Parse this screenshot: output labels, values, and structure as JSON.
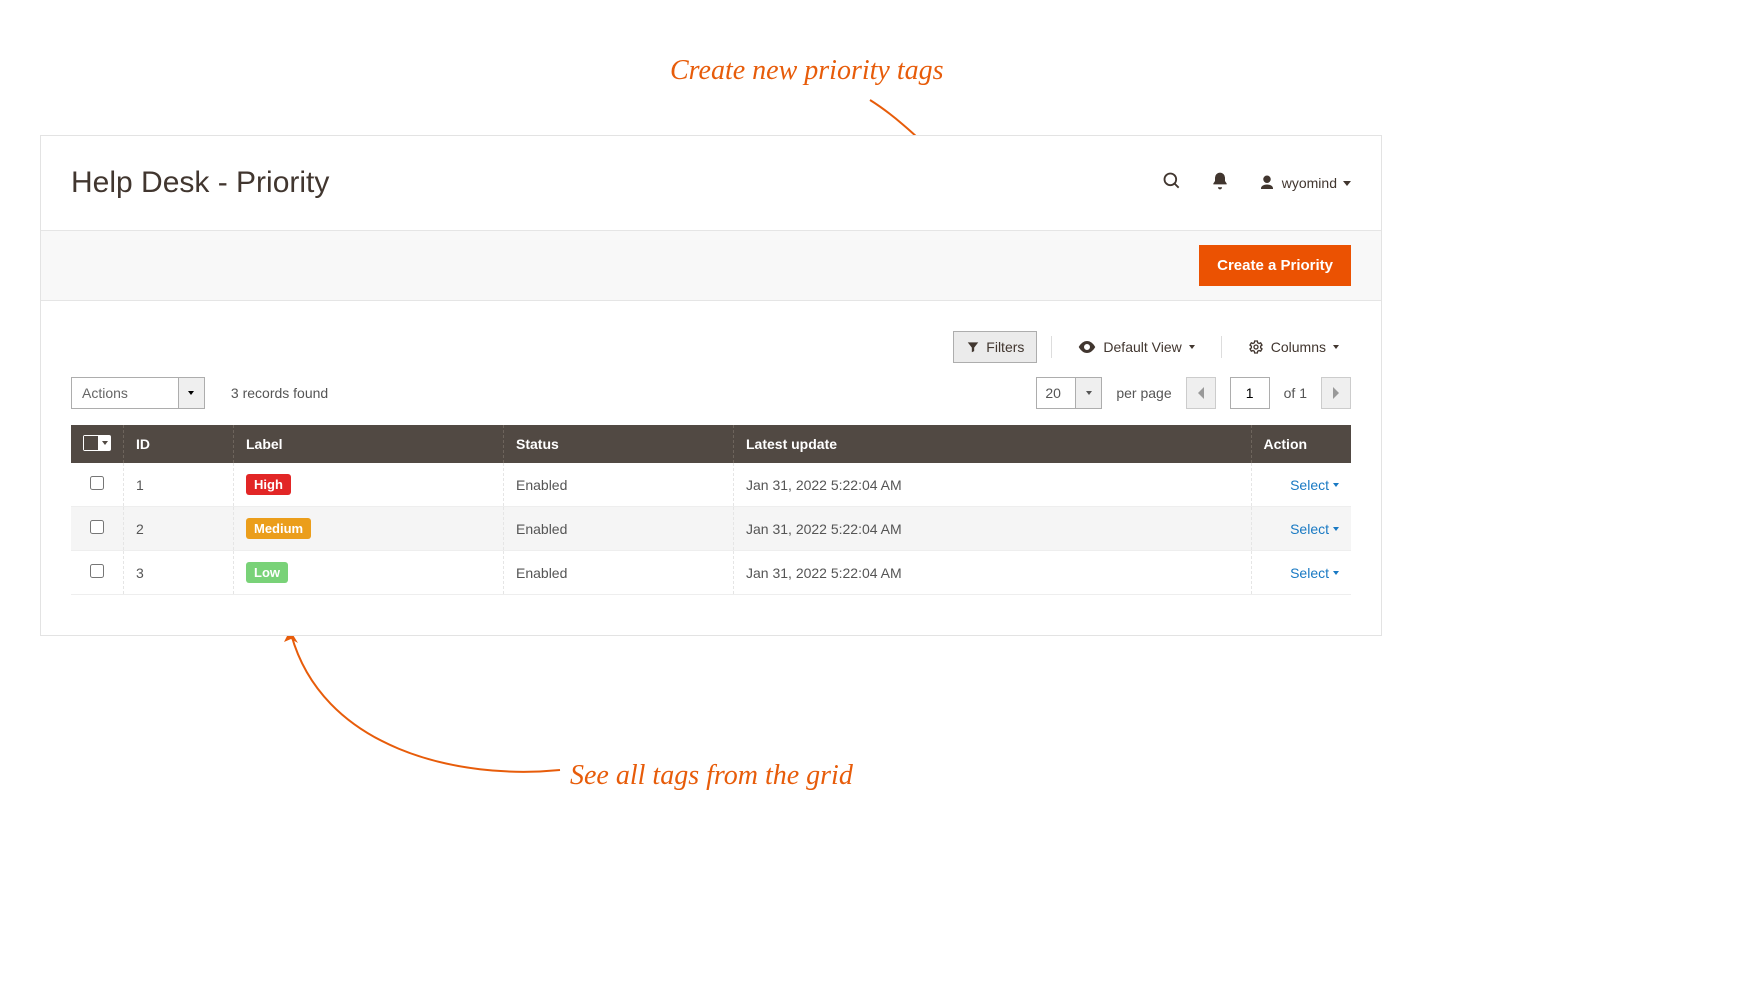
{
  "annotations": {
    "top": "Create new priority tags",
    "bottom": "See all tags from the grid"
  },
  "header": {
    "title": "Help Desk - Priority",
    "user": "wyomind"
  },
  "primary_button": "Create a Priority",
  "toolbar": {
    "filters": "Filters",
    "default_view": "Default View",
    "columns": "Columns"
  },
  "actions": {
    "label": "Actions",
    "records_found": "3 records found",
    "page_size": "20",
    "per_page": "per page",
    "current_page": "1",
    "of_pages": "of 1"
  },
  "grid": {
    "headers": {
      "id": "ID",
      "label": "Label",
      "status": "Status",
      "latest": "Latest update",
      "action": "Action"
    },
    "rows": [
      {
        "id": "1",
        "label": "High",
        "color": "red",
        "status": "Enabled",
        "latest": "Jan 31, 2022 5:22:04 AM",
        "action": "Select"
      },
      {
        "id": "2",
        "label": "Medium",
        "color": "orange",
        "status": "Enabled",
        "latest": "Jan 31, 2022 5:22:04 AM",
        "action": "Select"
      },
      {
        "id": "3",
        "label": "Low",
        "color": "green",
        "status": "Enabled",
        "latest": "Jan 31, 2022 5:22:04 AM",
        "action": "Select"
      }
    ]
  }
}
